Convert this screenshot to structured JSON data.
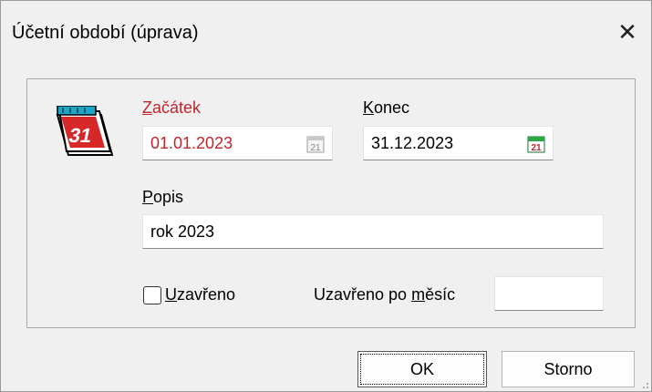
{
  "dialog": {
    "title": "Účetní období (úprava)"
  },
  "calendar_badge": "31",
  "start": {
    "label_prefix": "",
    "label_accel": "Z",
    "label_rest": "ačátek",
    "value": "01.01.2023",
    "picker_icon": "21"
  },
  "end": {
    "label_accel": "K",
    "label_rest": "onec",
    "value": "31.12.2023",
    "picker_icon": "21"
  },
  "description": {
    "label_accel": "P",
    "label_rest": "opis",
    "value": "rok 2023"
  },
  "closed": {
    "label_accel": "U",
    "label_rest": "zavřeno",
    "checked": false
  },
  "closed_month": {
    "label_before": "Uzavřeno po ",
    "label_accel": "m",
    "label_after": "ěsíc",
    "value": ""
  },
  "buttons": {
    "ok": "OK",
    "cancel": "Storno"
  },
  "colors": {
    "required_label": "#c0262d",
    "dialog_bg": "#f0f0f0"
  }
}
